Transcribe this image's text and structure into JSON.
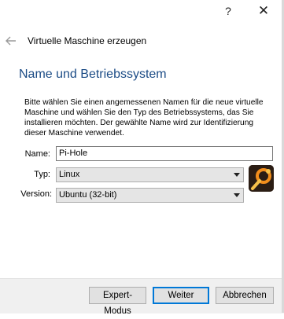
{
  "titlebar": {
    "help_label": "?",
    "close_label": "✕"
  },
  "wizard": {
    "title": "Virtuelle Maschine erzeugen",
    "page_heading": "Name und Betriebssystem",
    "description": "Bitte wählen Sie einen angemessenen Namen für die neue virtuelle Maschine und wählen Sie den Typ des Betriebssystems, das Sie installieren möchten. Der gewählte Name wird zur Identifizierung dieser Maschine verwendet."
  },
  "form": {
    "name_label": "Name:",
    "name_value": "Pi-Hole",
    "type_label": "Typ:",
    "type_value": "Linux",
    "version_label": "Version:",
    "version_value": "Ubuntu (32-bit)"
  },
  "buttons": {
    "expert": "Expert-Modus",
    "next": "Weiter",
    "cancel": "Abbrechen"
  },
  "icons": {
    "back": "back-arrow-icon",
    "os": "ubuntu-os-icon"
  },
  "colors": {
    "heading": "#1c4c86",
    "default_button_border": "#0078d7",
    "os_icon_accent": "#f28e1c"
  }
}
